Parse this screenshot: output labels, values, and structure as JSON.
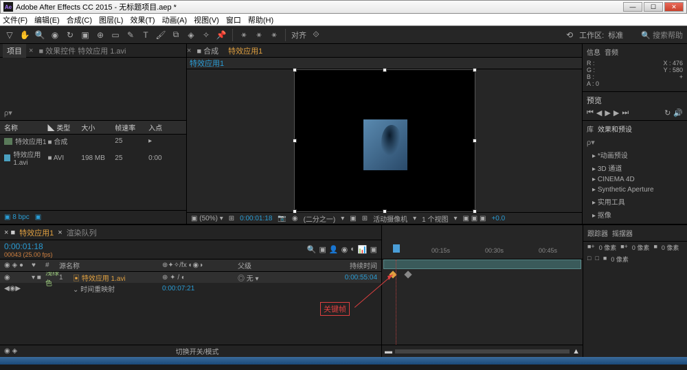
{
  "app": {
    "title": "Adobe After Effects CC 2015 - 无标题项目.aep *",
    "icon": "Ae"
  },
  "menu": [
    "文件(F)",
    "编辑(E)",
    "合成(C)",
    "图层(L)",
    "效果(T)",
    "动画(A)",
    "视图(V)",
    "窗口",
    "帮助(H)"
  ],
  "toolbar": {
    "align_label": "对齐",
    "workspace_label": "工作区:",
    "workspace_value": "标准",
    "search_placeholder": "搜索帮助"
  },
  "project": {
    "tab": "项目",
    "item_label": "效果控件 特效应用 1.avi",
    "cols": {
      "name": "名称",
      "type": "类型",
      "size": "大小",
      "fps": "帧速率",
      "in": "入点"
    },
    "rows": [
      {
        "name": "特效应用1",
        "type": "合成",
        "size": "",
        "fps": "25",
        "in": ""
      },
      {
        "name": "特效应用 1.avi",
        "type": "AVI",
        "size": "198 MB",
        "fps": "25",
        "in": "0:00"
      }
    ],
    "bpc": "8 bpc"
  },
  "comp": {
    "tab_prefix": "合成",
    "name": "特效应用1",
    "footer": {
      "zoom": "(50%)",
      "tc": "0:00:01:18",
      "res": "(二分之一)",
      "cam": "活动摄像机",
      "view": "1 个视图",
      "extra": "+0.0"
    }
  },
  "info": {
    "tab1": "信息",
    "tab2": "音频",
    "r": "R :",
    "g": "G :",
    "b": "B :",
    "a": "A : 0",
    "x": "X : 476",
    "y": "Y : 580"
  },
  "preview": {
    "label": "预览"
  },
  "effects": {
    "tab1": "库",
    "tab2": "效果和预设",
    "items": [
      "*动画预设",
      "3D 通道",
      "CINEMA 4D",
      "Synthetic Aperture",
      "实用工具",
      "抠像"
    ]
  },
  "timeline": {
    "tab": "特效应用1",
    "render_queue": "渲染队列",
    "tc": "0:00:01:18",
    "fps": "00043 (25.00 fps)",
    "cols": {
      "num": "#",
      "src": "源名称",
      "parent": "父级",
      "dur": "持续时间"
    },
    "layer": {
      "num": "1",
      "label": "浅绿色",
      "name": "特效应用 1.avi",
      "parent": "无",
      "dur": "0:00:55:04",
      "prop": "时间重映射",
      "prop_val": "0:00:07:21"
    },
    "marks": [
      "00:15s",
      "00:30s",
      "00:45s"
    ],
    "footer": "切换开关/模式",
    "annotation": "关键帧"
  },
  "tracker": {
    "tab1": "跟踪器",
    "tab2": "摇摆器",
    "r1a": "0 像素",
    "r1b": "0 像素",
    "r1c": "0 像素",
    "r2a": "0 像素"
  }
}
